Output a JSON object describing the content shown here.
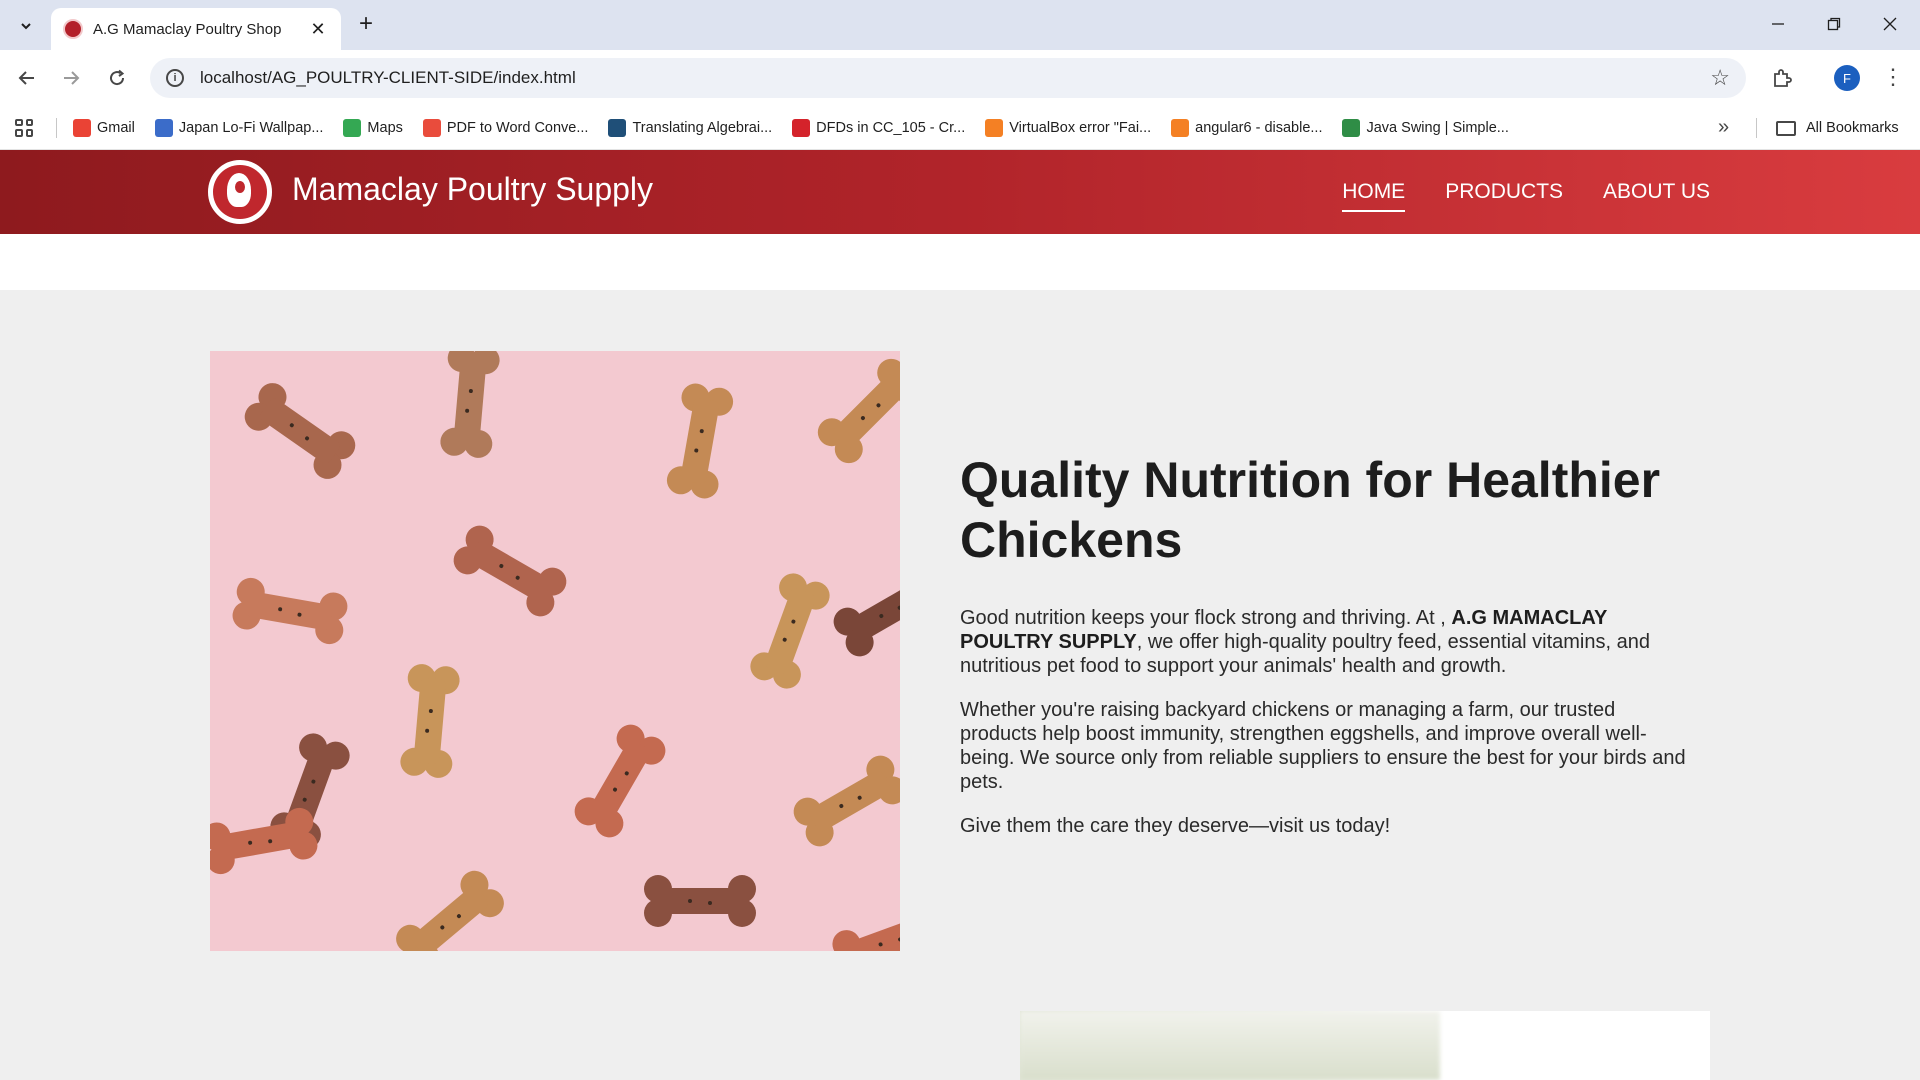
{
  "browser": {
    "tab_title": "A.G Mamaclay Poultry Shop",
    "url": "localhost/AG_POULTRY-CLIENT-SIDE/index.html",
    "profile_initial": "F",
    "bookmarks": [
      {
        "label": "Gmail",
        "icon": "gmail-icon",
        "color": "#ea4335"
      },
      {
        "label": "Japan Lo-Fi Wallpap...",
        "icon": "w-icon",
        "color": "#3b6cc9"
      },
      {
        "label": "Maps",
        "icon": "maps-icon",
        "color": "#34a853"
      },
      {
        "label": "PDF to Word Conve...",
        "icon": "pdf-icon",
        "color": "#e94c3c"
      },
      {
        "label": "Translating Algebrai...",
        "icon": "cube-icon",
        "color": "#1f4f78"
      },
      {
        "label": "DFDs in CC_105 - Cr...",
        "icon": "link-icon",
        "color": "#d4232b"
      },
      {
        "label": "VirtualBox error \"Fai...",
        "icon": "stack-icon",
        "color": "#f48024"
      },
      {
        "label": "angular6 - disable...",
        "icon": "stack-icon",
        "color": "#f48024"
      },
      {
        "label": "Java Swing | Simple...",
        "icon": "gfg-icon",
        "color": "#2f8d46"
      }
    ],
    "all_bookmarks": "All Bookmarks"
  },
  "site": {
    "brand": "Mamaclay Poultry Supply",
    "nav": [
      {
        "label": "HOME",
        "active": true
      },
      {
        "label": "PRODUCTS",
        "active": false
      },
      {
        "label": "ABOUT US",
        "active": false
      }
    ],
    "colors": {
      "nav_start": "#8e1a1e",
      "nav_end": "#d93c3f",
      "hero_bg": "#f3c9d0"
    }
  },
  "hero": {
    "title": "Quality Nutrition for Healthier Chickens",
    "p1_before": "Good nutrition keeps your flock strong and thriving. At , ",
    "p1_bold": "A.G MAMACLAY POULTRY SUPPLY",
    "p1_after": ", we offer high-quality poultry feed, essential vitamins, and nutritious pet food to support your animals' health and growth.",
    "p2": "Whether you're raising backyard chickens or managing a farm, our trusted products help boost immunity, strengthen eggshells, and improve overall well-being. We source only from reliable suppliers to ensure the best for your birds and pets.",
    "p3": "Give them the care they deserve—visit us today!"
  }
}
